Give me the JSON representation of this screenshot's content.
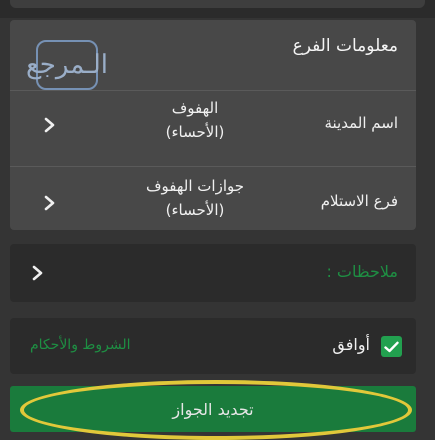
{
  "watermark": "الـمرجع",
  "branch_info": {
    "title": "معلومات الفرع",
    "rows": [
      {
        "label": "اسم المدينة",
        "value_line1": "الهفوف",
        "value_line2": "(الأحساء)"
      },
      {
        "label": "فرع الاستلام",
        "value_line1": "جوازات الهفوف",
        "value_line2": "(الأحساء)"
      }
    ]
  },
  "notes": {
    "label": "ملاحظات :"
  },
  "agreement": {
    "checked": true,
    "label": "أوافق",
    "terms_link": "الشروط والأحكام"
  },
  "submit": {
    "label": "تجديد الجواز"
  },
  "colors": {
    "accent_green": "#1a7b3c",
    "link_green": "#1e8f43",
    "highlight_yellow": "#e1c83a"
  }
}
